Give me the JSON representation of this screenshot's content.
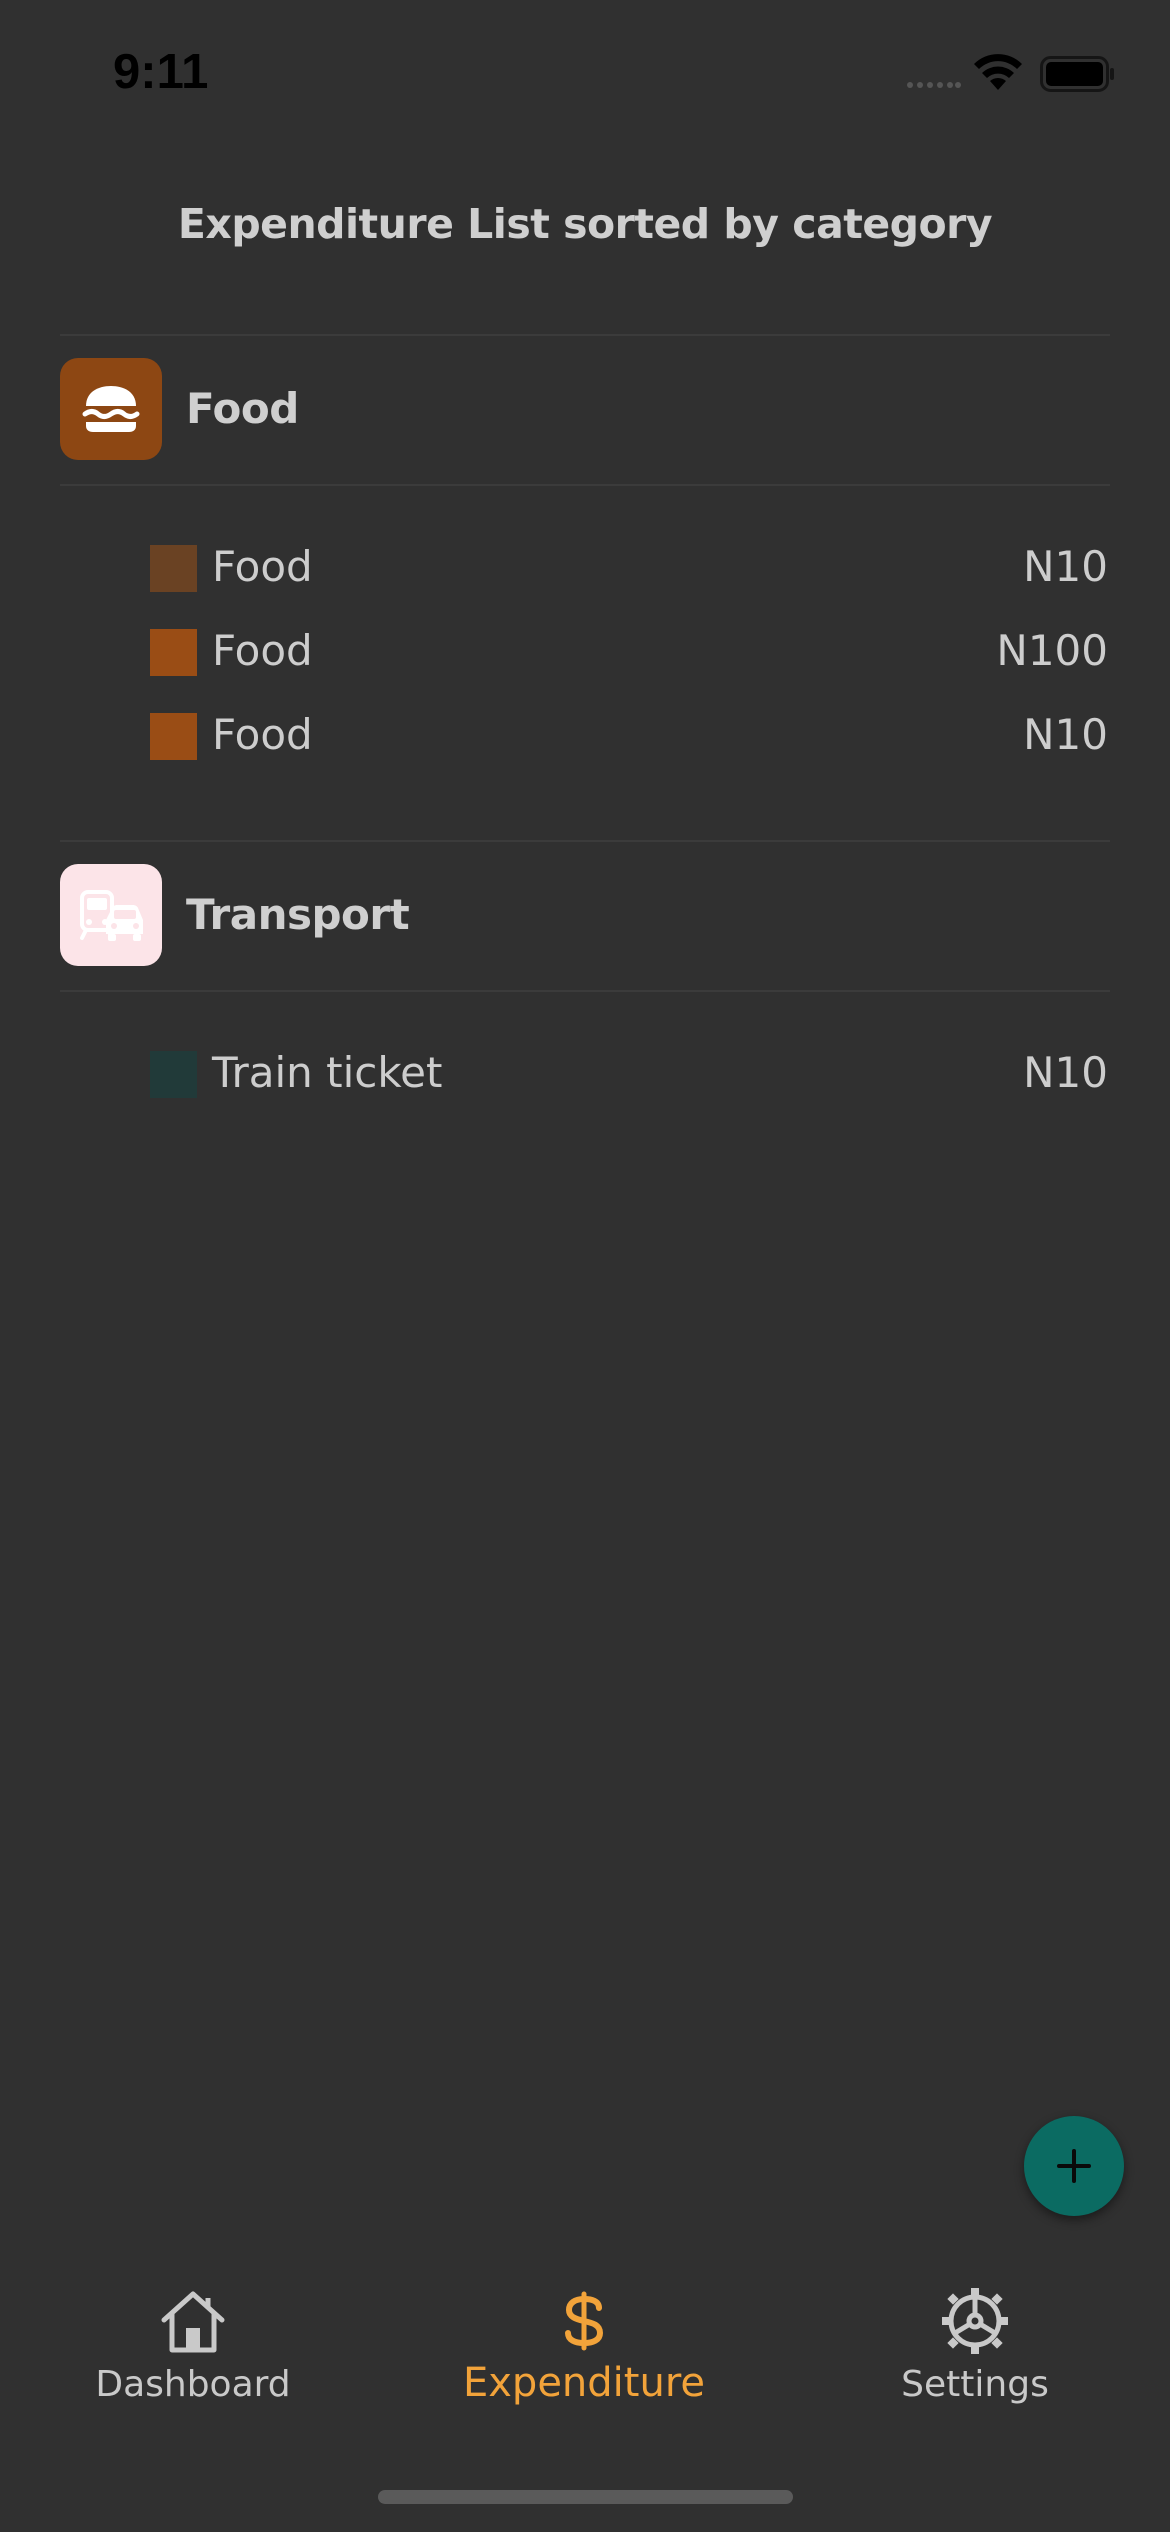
{
  "status_bar": {
    "time": "9:11"
  },
  "page": {
    "title": "Expenditure List sorted by category"
  },
  "categories": [
    {
      "name": "Food",
      "icon": "burger-icon",
      "icon_bg": "#8d4713",
      "items": [
        {
          "label": "Food",
          "amount": "N10",
          "color": "#6a4223"
        },
        {
          "label": "Food",
          "amount": "N100",
          "color": "#9a4d15"
        },
        {
          "label": "Food",
          "amount": "N10",
          "color": "#9a4d15"
        }
      ]
    },
    {
      "name": "Transport",
      "icon": "vehicle-icon",
      "icon_bg": "#fce4e8",
      "items": [
        {
          "label": "Train ticket",
          "amount": "N10",
          "color": "#213a39"
        }
      ]
    }
  ],
  "fab": {
    "icon": "plus-icon",
    "color": "#0b6b62"
  },
  "tabs": [
    {
      "label": "Dashboard",
      "icon": "home-icon",
      "active": false
    },
    {
      "label": "Expenditure",
      "icon": "dollar-icon",
      "active": true
    },
    {
      "label": "Settings",
      "icon": "settings-gear-icon",
      "active": false
    }
  ],
  "colors": {
    "background": "#303030",
    "accent": "#f2a33a",
    "text": "#cdcdcd"
  }
}
